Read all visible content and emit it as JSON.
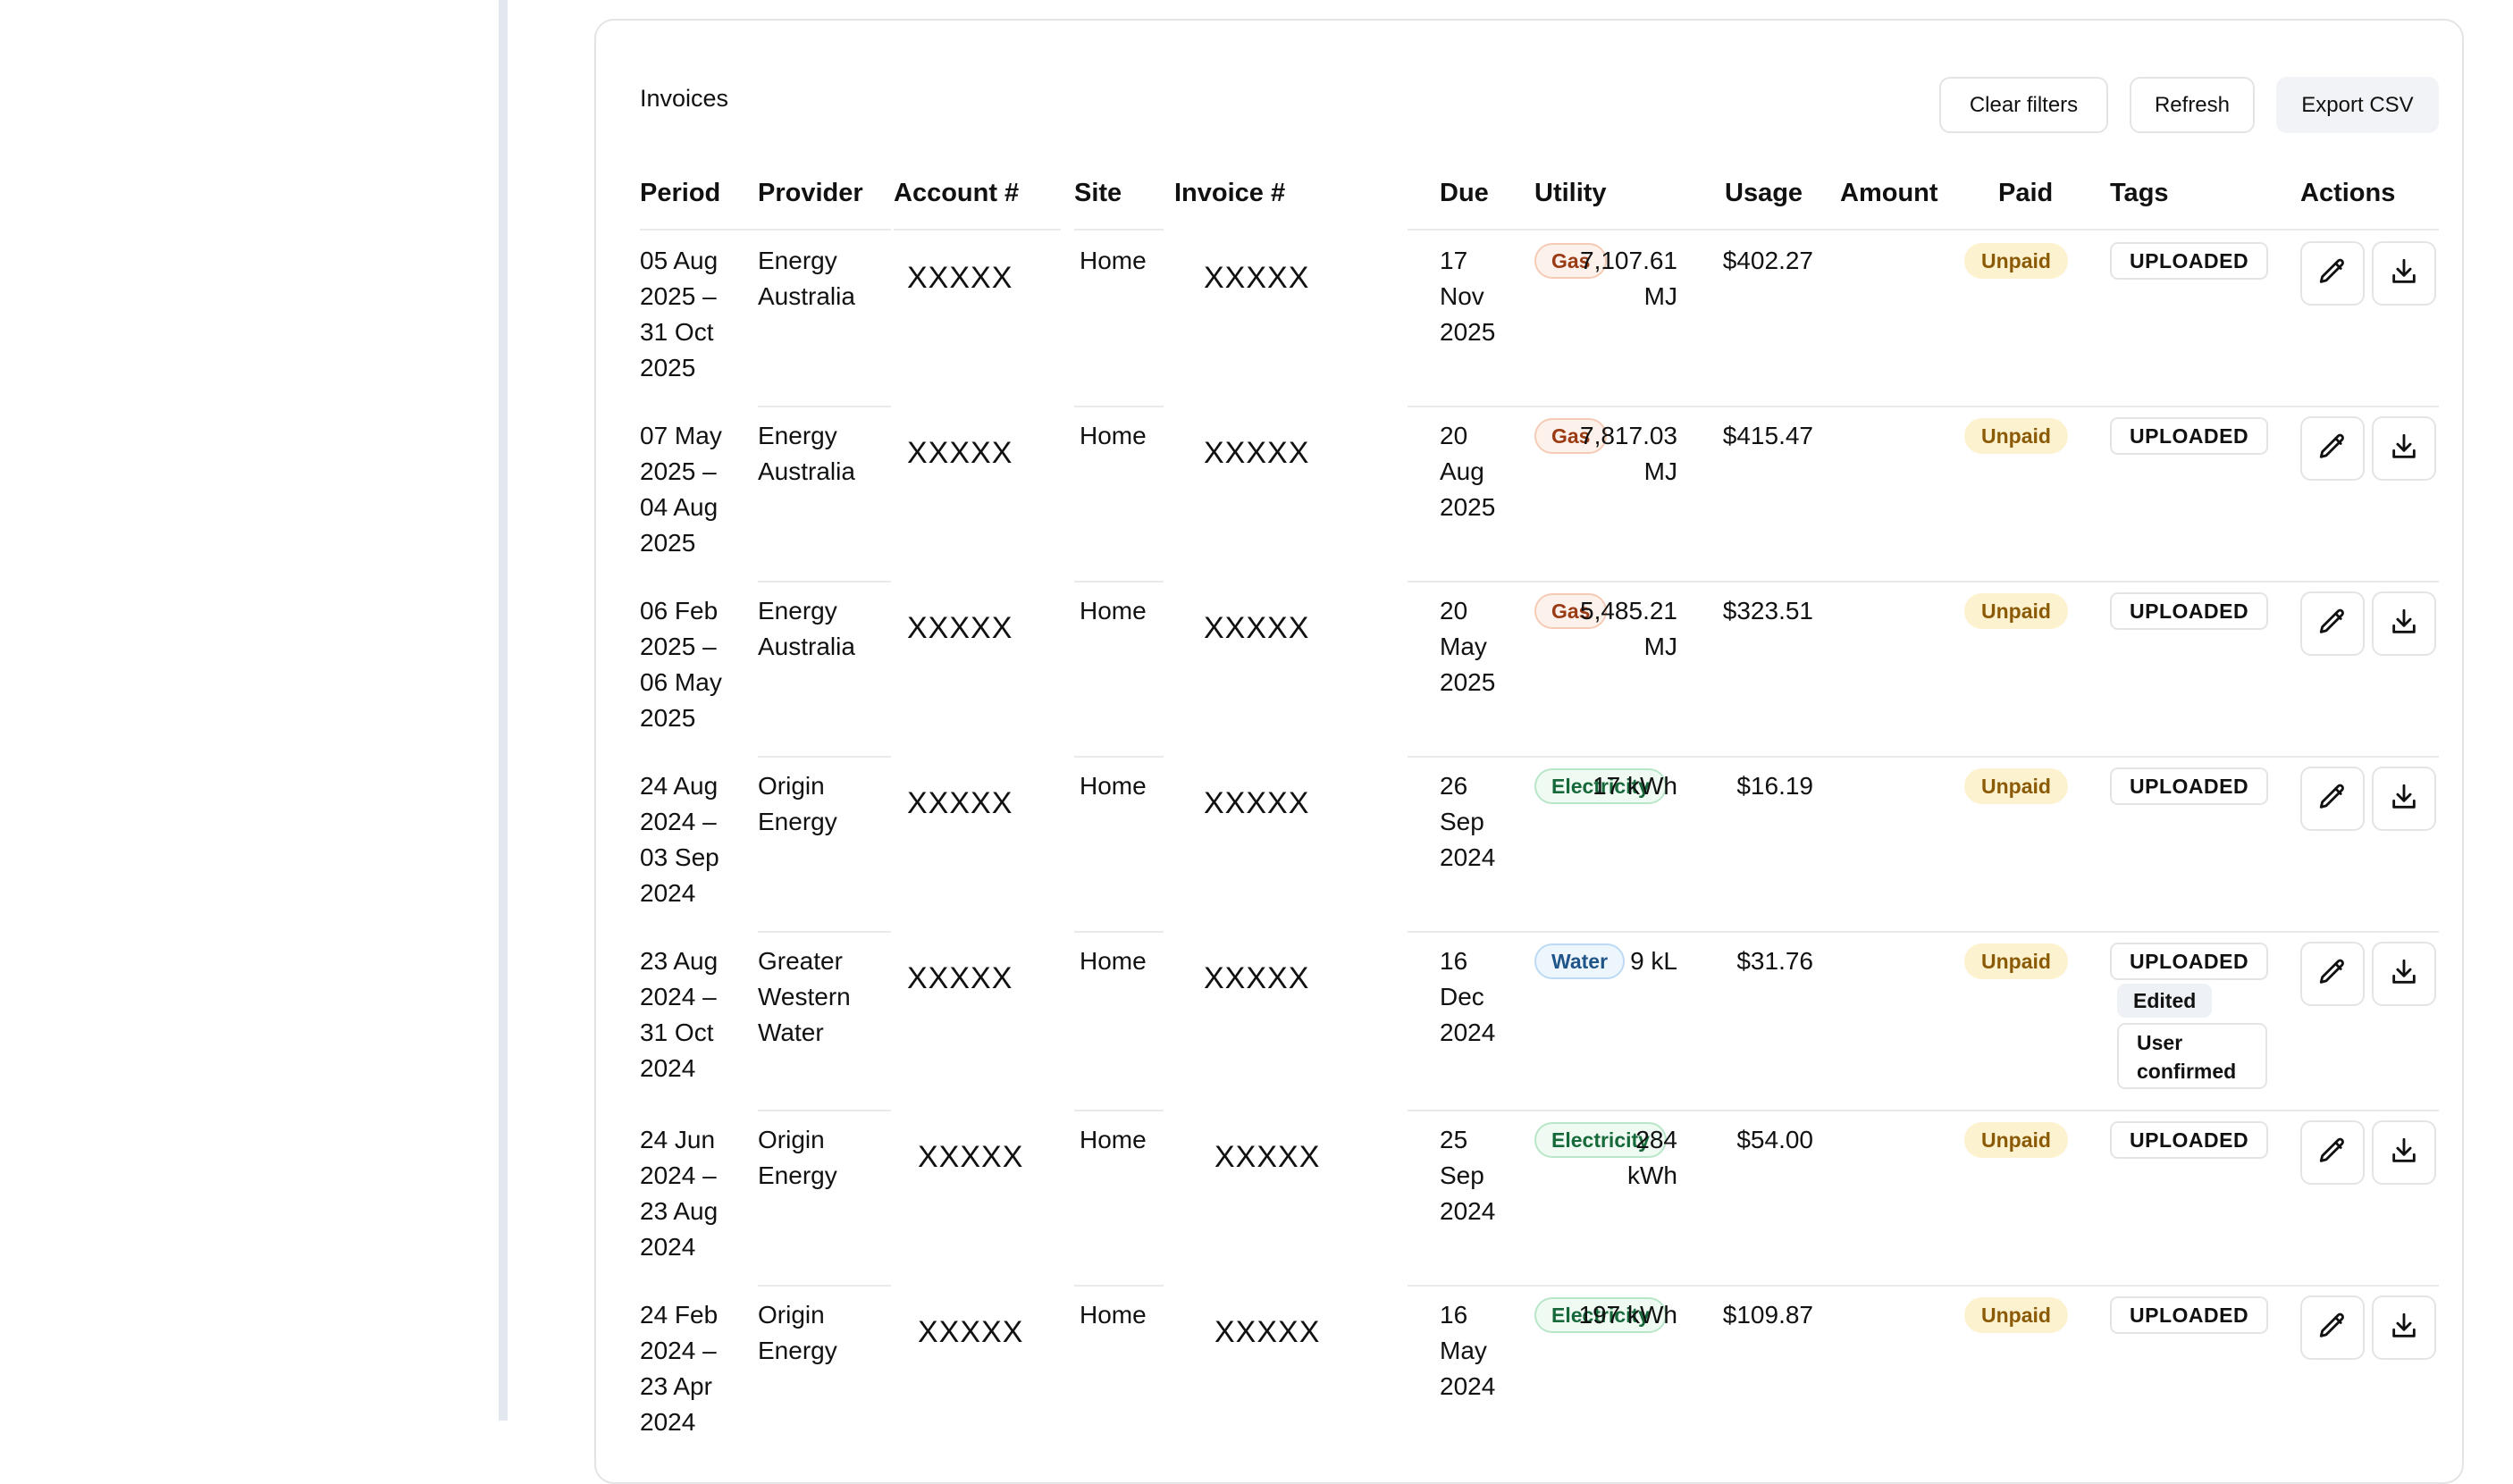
{
  "invoices_panel": {
    "title": "Invoices",
    "clear_filters_label": "Clear filters",
    "refresh_label": "Refresh",
    "export_csv_label": "Export CSV"
  },
  "table": {
    "headers": {
      "period": "Period",
      "provider": "Provider",
      "account": "Account #",
      "site": "Site",
      "invoice": "Invoice #",
      "due": "Due",
      "utility": "Utility",
      "usage": "Usage",
      "amount": "Amount",
      "paid": "Paid",
      "tags": "Tags",
      "actions": "Actions"
    },
    "rows": [
      {
        "period": [
          "05 Aug",
          "2025 –",
          "31 Oct",
          "2025"
        ],
        "provider": [
          "Energy",
          "Australia"
        ],
        "account": "XXXXX",
        "site": "Home",
        "invoice": "XXXXX",
        "due": [
          "17",
          "Nov",
          "2025"
        ],
        "utility": "Gas",
        "usage": [
          "7,107.61",
          "MJ"
        ],
        "amount": "$402.27",
        "paid": "Unpaid",
        "tags": [
          "UPLOADED"
        ]
      },
      {
        "period": [
          "07 May",
          "2025 –",
          "04 Aug",
          "2025"
        ],
        "provider": [
          "Energy",
          "Australia"
        ],
        "account": "XXXXX",
        "site": "Home",
        "invoice": "XXXXX",
        "due": [
          "20",
          "Aug",
          "2025"
        ],
        "utility": "Gas",
        "usage": [
          "7,817.03",
          "MJ"
        ],
        "amount": "$415.47",
        "paid": "Unpaid",
        "tags": [
          "UPLOADED"
        ]
      },
      {
        "period": [
          "06 Feb",
          "2025 –",
          "06 May",
          "2025"
        ],
        "provider": [
          "Energy",
          "Australia"
        ],
        "account": "XXXXX",
        "site": "Home",
        "invoice": "XXXXX",
        "due": [
          "20",
          "May",
          "2025"
        ],
        "utility": "Gas",
        "usage": [
          "5,485.21",
          "MJ"
        ],
        "amount": "$323.51",
        "paid": "Unpaid",
        "tags": [
          "UPLOADED"
        ]
      },
      {
        "period": [
          "24 Aug",
          "2024 –",
          "03 Sep",
          "2024"
        ],
        "provider": [
          "Origin",
          "Energy"
        ],
        "account": "XXXXX",
        "site": "Home",
        "invoice": "XXXXX",
        "due": [
          "26",
          "Sep",
          "2024"
        ],
        "utility": "Electricity",
        "usage": [
          "17 kWh"
        ],
        "amount": "$16.19",
        "paid": "Unpaid",
        "tags": [
          "UPLOADED"
        ]
      },
      {
        "period": [
          "23 Aug",
          "2024 –",
          "31 Oct",
          "2024"
        ],
        "provider": [
          "Greater",
          "Western",
          "Water"
        ],
        "account": "XXXXX",
        "site": "Home",
        "invoice": "XXXXX",
        "due": [
          "16",
          "Dec",
          "2024"
        ],
        "utility": "Water",
        "usage": [
          "9 kL"
        ],
        "amount": "$31.76",
        "paid": "Unpaid",
        "tags": [
          "UPLOADED",
          "Edited",
          "User confirmed"
        ]
      },
      {
        "period": [
          "24 Jun",
          "2024 –",
          "23 Aug",
          "2024"
        ],
        "provider": [
          "Origin",
          "Energy"
        ],
        "account": "XXXXX",
        "site": "Home",
        "invoice": "XXXXX",
        "due": [
          "25",
          "Sep",
          "2024"
        ],
        "utility": "Electricity",
        "usage": [
          "284",
          "kWh"
        ],
        "amount": "$54.00",
        "paid": "Unpaid",
        "tags": [
          "UPLOADED"
        ]
      },
      {
        "period": [
          "24 Feb",
          "2024 –",
          "23 Apr",
          "2024"
        ],
        "provider": [
          "Origin",
          "Energy"
        ],
        "account": "XXXXX",
        "site": "Home",
        "invoice": "XXXXX",
        "due": [
          "16",
          "May",
          "2024"
        ],
        "utility": "Electricity",
        "usage": [
          "197 kWh"
        ],
        "amount": "$109.87",
        "paid": "Unpaid",
        "tags": [
          "UPLOADED"
        ]
      }
    ]
  },
  "colors": {
    "gas": "#9a3b13",
    "electricity": "#17693a",
    "water": "#1f5588",
    "unpaid": "#8a5a06"
  },
  "icons": {
    "edit": "pencil-icon",
    "download": "download-icon"
  }
}
